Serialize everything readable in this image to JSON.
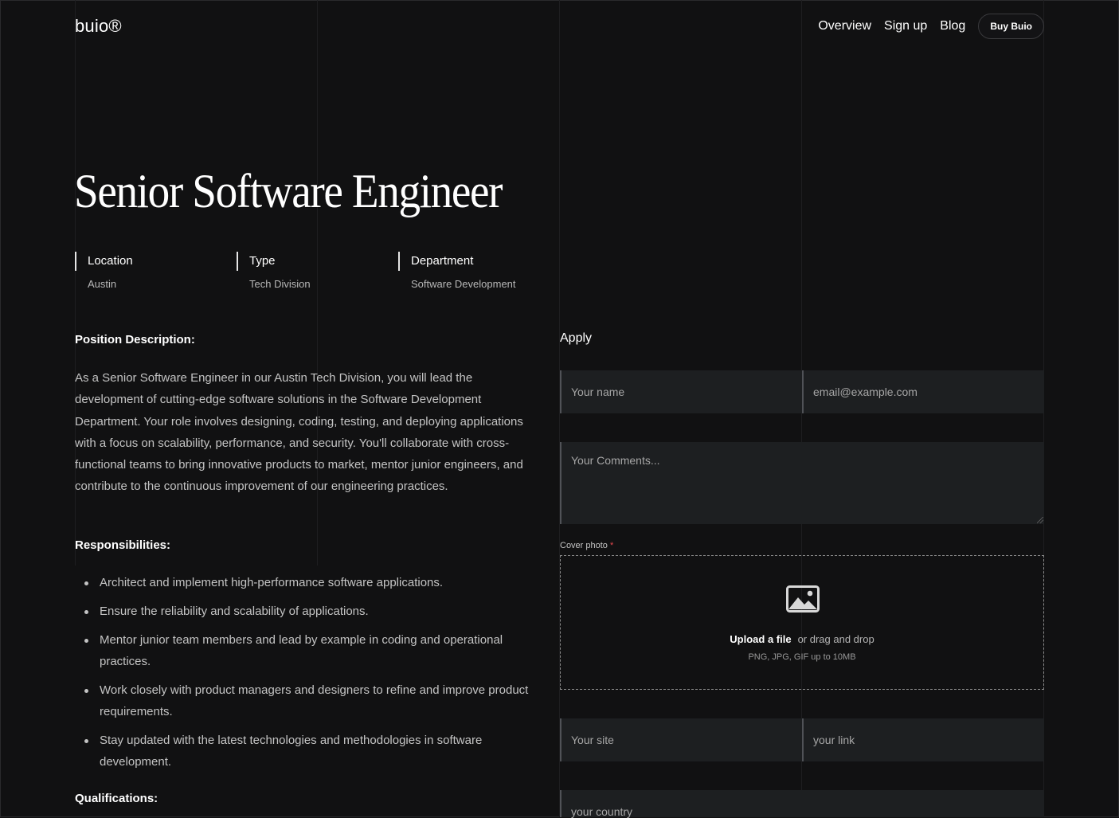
{
  "header": {
    "logo": "buio®",
    "nav": [
      "Overview",
      "Sign up",
      "Blog"
    ],
    "buy_label": "Buy Buio"
  },
  "job": {
    "title": "Senior Software Engineer",
    "meta": [
      {
        "label": "Location",
        "value": "Austin"
      },
      {
        "label": "Type",
        "value": "Tech Division"
      },
      {
        "label": "Department",
        "value": "Software Development"
      }
    ],
    "description_title": "Position Description:",
    "description": "As a Senior Software Engineer in our Austin Tech Division, you will lead the development of cutting-edge software solutions in the Software Development Department. Your role involves designing, coding, testing, and deploying applications with a focus on scalability, performance, and security. You'll collaborate with cross-functional teams to bring innovative products to market, mentor junior engineers, and contribute to the continuous improvement of our engineering practices.",
    "responsibilities_title": "Responsibilities:",
    "responsibilities": [
      "Architect and implement high-performance software applications.",
      "Ensure the reliability and scalability of applications.",
      "Mentor junior team members and lead by example in coding and operational practices.",
      "Work closely with product managers and designers to refine and improve product requirements.",
      "Stay updated with the latest technologies and methodologies in software development."
    ],
    "qualifications_title": "Qualifications:"
  },
  "apply": {
    "title": "Apply",
    "name_placeholder": "Your name",
    "email_placeholder": "email@example.com",
    "comments_placeholder": "Your Comments...",
    "cover_label": "Cover photo",
    "required_mark": "*",
    "upload_link": "Upload a file",
    "upload_text": "or drag and drop",
    "upload_hint": "PNG, JPG, GIF up to 10MB",
    "site_placeholder": "Your site",
    "link_placeholder": "your link",
    "country_placeholder": "your country"
  },
  "colors": {
    "background": "#111112",
    "field_background": "#1d1f21",
    "required": "#e5484d"
  },
  "icons": {
    "upload": "image-icon"
  }
}
